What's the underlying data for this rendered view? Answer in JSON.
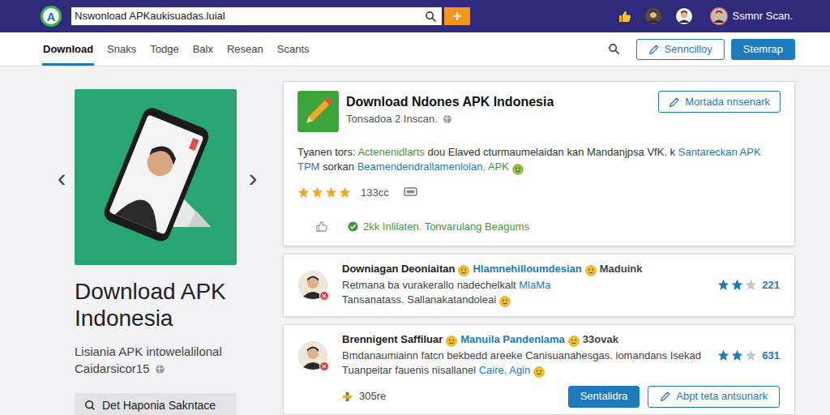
{
  "topbar": {
    "logo": "A",
    "search": {
      "value": "Nswonload APKaukisuadas.luial"
    },
    "add": "+",
    "user": "Ssmnr Scan."
  },
  "nav": {
    "tabs": [
      {
        "label": "Download",
        "selected": true
      },
      {
        "label": "Snaks",
        "selected": false
      },
      {
        "label": "Todge",
        "selected": false
      },
      {
        "label": "Balx",
        "selected": false
      },
      {
        "label": "Resean",
        "selected": false
      },
      {
        "label": "Scants",
        "selected": false
      }
    ],
    "buttons": [
      {
        "label": "Senncilloy",
        "kind": "outline"
      },
      {
        "label": "Stemrap",
        "kind": "filled"
      }
    ]
  },
  "hero": {
    "prev": "‹",
    "next": "›",
    "title": "Download APK Indonesia",
    "subtitle": "Lisiania APK intowelalilonal Caidarsicor15",
    "button": "Det Haponia Sakntace"
  },
  "app": {
    "title": "Download Ndones APK Indonesia",
    "subtitle": "Tonsadoa 2 Inscan.",
    "action": "Mortada nnsenark",
    "description": [
      {
        "kind": "text",
        "text": "Tyanen tors: ",
        "color": "#333333"
      },
      {
        "kind": "text",
        "text": "Actenenidlarts",
        "color": "#3c9a3c"
      },
      {
        "kind": "text",
        "text": " dou Elaved cturmaumelaidan kan Mandanjpsa VfK. k ",
        "color": "#333333"
      },
      {
        "kind": "text",
        "text": "Santareckan APK TPM",
        "color": "#1b7bbd"
      },
      {
        "kind": "text",
        "text": " sorkan ",
        "color": "#333333"
      },
      {
        "kind": "text",
        "text": "Beamendendrallamenlolan.",
        "color": "#1b7bbd"
      },
      {
        "kind": "text",
        "text": " APK",
        "color": "#3c9a3c"
      },
      {
        "kind": "emoji",
        "color": "#86c44e"
      }
    ],
    "stars": 4,
    "rating_count": "133cc",
    "install_note": "2kk Inlilaten. Tonvarulang Beagums"
  },
  "reviews": [
    {
      "header": [
        {
          "kind": "text",
          "text": "Downiagan Deoniaitan",
          "color": "#222222"
        },
        {
          "kind": "emoji",
          "color": "#f6c325"
        },
        {
          "kind": "text",
          "text": "Hlamnehilloumdesian",
          "color": "#1b7bbd"
        },
        {
          "kind": "emoji",
          "color": "#f6c325"
        },
        {
          "kind": "text",
          "text": "Maduink",
          "color": "#444444"
        }
      ],
      "lines": [
        [
          {
            "kind": "text",
            "text": "Retmana ba vurakerallo nadechelkalt ",
            "color": "#444444"
          },
          {
            "kind": "text",
            "text": "MlaMa",
            "color": "#1b7bbd"
          }
        ],
        [
          {
            "kind": "text",
            "text": "Tansanatass. Sallanakatandoleai",
            "color": "#444444"
          },
          {
            "kind": "emoji",
            "color": "#f6c325"
          }
        ]
      ],
      "stars": 2,
      "rating": "221"
    },
    {
      "header": [
        {
          "kind": "text",
          "text": "Brennigent Saffiluar",
          "color": "#222222"
        },
        {
          "kind": "emoji",
          "color": "#f6c325"
        },
        {
          "kind": "text",
          "text": "Manuila Pandenlama",
          "color": "#1b7bbd"
        },
        {
          "kind": "emoji",
          "color": "#f6c325"
        },
        {
          "kind": "text",
          "text": "33ovak",
          "color": "#444444"
        }
      ],
      "lines": [
        [
          {
            "kind": "text",
            "text": "Bmdanaumiainn fatcn bekbedd areeke Canisuanahesgas. iomandans Isekad",
            "color": "#444444"
          }
        ],
        [
          {
            "kind": "text",
            "text": "Tuanpeitar fauenis nisallanel ",
            "color": "#444444"
          },
          {
            "kind": "text",
            "text": "Caire, Agin",
            "color": "#1b7bbd"
          },
          {
            "kind": "emoji",
            "color": "#f6c325"
          }
        ]
      ],
      "stars": 2,
      "rating": "631",
      "footer": {
        "count": "305re",
        "buttons": [
          {
            "label": "Sentalidra",
            "kind": "filled"
          },
          {
            "label": "Abpt teta antsunark",
            "kind": "outline"
          }
        ]
      }
    }
  ]
}
